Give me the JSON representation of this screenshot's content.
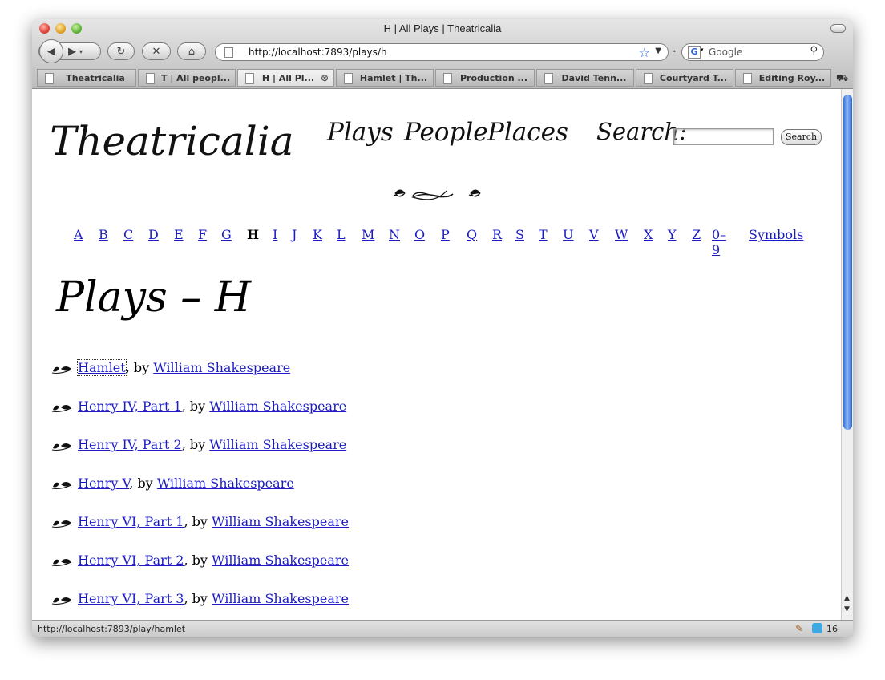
{
  "browser": {
    "window_title": "H | All Plays | Theatricalia",
    "url": "http://localhost:7893/plays/h",
    "search_engine_placeholder": "Google",
    "status_url": "http://localhost:7893/play/hamlet",
    "status_count": "16"
  },
  "tabs": [
    {
      "label": "Theatricalia",
      "active": false
    },
    {
      "label": "T | All peopl...",
      "active": false
    },
    {
      "label": "H | All Pl...",
      "active": true
    },
    {
      "label": "Hamlet | Th...",
      "active": false
    },
    {
      "label": "Production ...",
      "active": false
    },
    {
      "label": "David Tenn...",
      "active": false
    },
    {
      "label": "Courtyard T...",
      "active": false
    },
    {
      "label": "Editing Roy...",
      "active": false
    }
  ],
  "site": {
    "logo": "Theatricalia",
    "nav": [
      "Plays",
      "People",
      "Places"
    ],
    "search_label": "Search:",
    "search_button": "Search"
  },
  "alphabet": [
    "A",
    "B",
    "C",
    "D",
    "E",
    "F",
    "G",
    "H",
    "I",
    "J",
    "K",
    "L",
    "M",
    "N",
    "O",
    "P",
    "Q",
    "R",
    "S",
    "T",
    "U",
    "V",
    "W",
    "X",
    "Y",
    "Z",
    "0–9",
    "Symbols"
  ],
  "current_letter": "H",
  "page_heading": "Plays – H",
  "by_text": ", by ",
  "plays": [
    {
      "title": "Hamlet",
      "author": "William Shakespeare"
    },
    {
      "title": "Henry IV, Part 1",
      "author": "William Shakespeare"
    },
    {
      "title": "Henry IV, Part 2",
      "author": "William Shakespeare"
    },
    {
      "title": "Henry V",
      "author": "William Shakespeare"
    },
    {
      "title": "Henry VI, Part 1",
      "author": "William Shakespeare"
    },
    {
      "title": "Henry VI, Part 2",
      "author": "William Shakespeare"
    },
    {
      "title": "Henry VI, Part 3",
      "author": "William Shakespeare"
    }
  ],
  "colors": {
    "link": "#1c1cc4",
    "scroll_thumb": "#2f6fd8"
  }
}
